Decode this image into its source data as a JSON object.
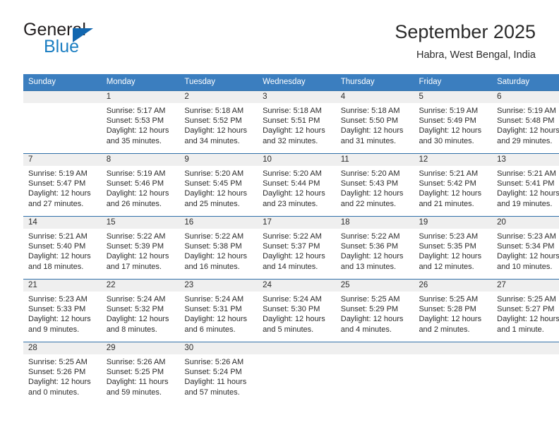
{
  "brand": {
    "word_top": "General",
    "word_bottom": "Blue",
    "accent_color": "#1267b0",
    "blue_text_color": "#1b7ec2"
  },
  "header": {
    "title": "September 2025",
    "subtitle": "Habra, West Bengal, India"
  },
  "calendar": {
    "header_bg": "#3b7ebf",
    "daynum_bg": "#efefef",
    "grid_line": "#2f6fa8",
    "weekday_headers": [
      "Sunday",
      "Monday",
      "Tuesday",
      "Wednesday",
      "Thursday",
      "Friday",
      "Saturday"
    ],
    "weeks": [
      [
        {
          "day": "",
          "lines": []
        },
        {
          "day": "1",
          "lines": [
            "Sunrise: 5:17 AM",
            "Sunset: 5:53 PM",
            "Daylight: 12 hours",
            "and 35 minutes."
          ]
        },
        {
          "day": "2",
          "lines": [
            "Sunrise: 5:18 AM",
            "Sunset: 5:52 PM",
            "Daylight: 12 hours",
            "and 34 minutes."
          ]
        },
        {
          "day": "3",
          "lines": [
            "Sunrise: 5:18 AM",
            "Sunset: 5:51 PM",
            "Daylight: 12 hours",
            "and 32 minutes."
          ]
        },
        {
          "day": "4",
          "lines": [
            "Sunrise: 5:18 AM",
            "Sunset: 5:50 PM",
            "Daylight: 12 hours",
            "and 31 minutes."
          ]
        },
        {
          "day": "5",
          "lines": [
            "Sunrise: 5:19 AM",
            "Sunset: 5:49 PM",
            "Daylight: 12 hours",
            "and 30 minutes."
          ]
        },
        {
          "day": "6",
          "lines": [
            "Sunrise: 5:19 AM",
            "Sunset: 5:48 PM",
            "Daylight: 12 hours",
            "and 29 minutes."
          ]
        }
      ],
      [
        {
          "day": "7",
          "lines": [
            "Sunrise: 5:19 AM",
            "Sunset: 5:47 PM",
            "Daylight: 12 hours",
            "and 27 minutes."
          ]
        },
        {
          "day": "8",
          "lines": [
            "Sunrise: 5:19 AM",
            "Sunset: 5:46 PM",
            "Daylight: 12 hours",
            "and 26 minutes."
          ]
        },
        {
          "day": "9",
          "lines": [
            "Sunrise: 5:20 AM",
            "Sunset: 5:45 PM",
            "Daylight: 12 hours",
            "and 25 minutes."
          ]
        },
        {
          "day": "10",
          "lines": [
            "Sunrise: 5:20 AM",
            "Sunset: 5:44 PM",
            "Daylight: 12 hours",
            "and 23 minutes."
          ]
        },
        {
          "day": "11",
          "lines": [
            "Sunrise: 5:20 AM",
            "Sunset: 5:43 PM",
            "Daylight: 12 hours",
            "and 22 minutes."
          ]
        },
        {
          "day": "12",
          "lines": [
            "Sunrise: 5:21 AM",
            "Sunset: 5:42 PM",
            "Daylight: 12 hours",
            "and 21 minutes."
          ]
        },
        {
          "day": "13",
          "lines": [
            "Sunrise: 5:21 AM",
            "Sunset: 5:41 PM",
            "Daylight: 12 hours",
            "and 19 minutes."
          ]
        }
      ],
      [
        {
          "day": "14",
          "lines": [
            "Sunrise: 5:21 AM",
            "Sunset: 5:40 PM",
            "Daylight: 12 hours",
            "and 18 minutes."
          ]
        },
        {
          "day": "15",
          "lines": [
            "Sunrise: 5:22 AM",
            "Sunset: 5:39 PM",
            "Daylight: 12 hours",
            "and 17 minutes."
          ]
        },
        {
          "day": "16",
          "lines": [
            "Sunrise: 5:22 AM",
            "Sunset: 5:38 PM",
            "Daylight: 12 hours",
            "and 16 minutes."
          ]
        },
        {
          "day": "17",
          "lines": [
            "Sunrise: 5:22 AM",
            "Sunset: 5:37 PM",
            "Daylight: 12 hours",
            "and 14 minutes."
          ]
        },
        {
          "day": "18",
          "lines": [
            "Sunrise: 5:22 AM",
            "Sunset: 5:36 PM",
            "Daylight: 12 hours",
            "and 13 minutes."
          ]
        },
        {
          "day": "19",
          "lines": [
            "Sunrise: 5:23 AM",
            "Sunset: 5:35 PM",
            "Daylight: 12 hours",
            "and 12 minutes."
          ]
        },
        {
          "day": "20",
          "lines": [
            "Sunrise: 5:23 AM",
            "Sunset: 5:34 PM",
            "Daylight: 12 hours",
            "and 10 minutes."
          ]
        }
      ],
      [
        {
          "day": "21",
          "lines": [
            "Sunrise: 5:23 AM",
            "Sunset: 5:33 PM",
            "Daylight: 12 hours",
            "and 9 minutes."
          ]
        },
        {
          "day": "22",
          "lines": [
            "Sunrise: 5:24 AM",
            "Sunset: 5:32 PM",
            "Daylight: 12 hours",
            "and 8 minutes."
          ]
        },
        {
          "day": "23",
          "lines": [
            "Sunrise: 5:24 AM",
            "Sunset: 5:31 PM",
            "Daylight: 12 hours",
            "and 6 minutes."
          ]
        },
        {
          "day": "24",
          "lines": [
            "Sunrise: 5:24 AM",
            "Sunset: 5:30 PM",
            "Daylight: 12 hours",
            "and 5 minutes."
          ]
        },
        {
          "day": "25",
          "lines": [
            "Sunrise: 5:25 AM",
            "Sunset: 5:29 PM",
            "Daylight: 12 hours",
            "and 4 minutes."
          ]
        },
        {
          "day": "26",
          "lines": [
            "Sunrise: 5:25 AM",
            "Sunset: 5:28 PM",
            "Daylight: 12 hours",
            "and 2 minutes."
          ]
        },
        {
          "day": "27",
          "lines": [
            "Sunrise: 5:25 AM",
            "Sunset: 5:27 PM",
            "Daylight: 12 hours",
            "and 1 minute."
          ]
        }
      ],
      [
        {
          "day": "28",
          "lines": [
            "Sunrise: 5:25 AM",
            "Sunset: 5:26 PM",
            "Daylight: 12 hours",
            "and 0 minutes."
          ]
        },
        {
          "day": "29",
          "lines": [
            "Sunrise: 5:26 AM",
            "Sunset: 5:25 PM",
            "Daylight: 11 hours",
            "and 59 minutes."
          ]
        },
        {
          "day": "30",
          "lines": [
            "Sunrise: 5:26 AM",
            "Sunset: 5:24 PM",
            "Daylight: 11 hours",
            "and 57 minutes."
          ]
        },
        {
          "day": "",
          "lines": []
        },
        {
          "day": "",
          "lines": []
        },
        {
          "day": "",
          "lines": []
        },
        {
          "day": "",
          "lines": []
        }
      ]
    ]
  }
}
